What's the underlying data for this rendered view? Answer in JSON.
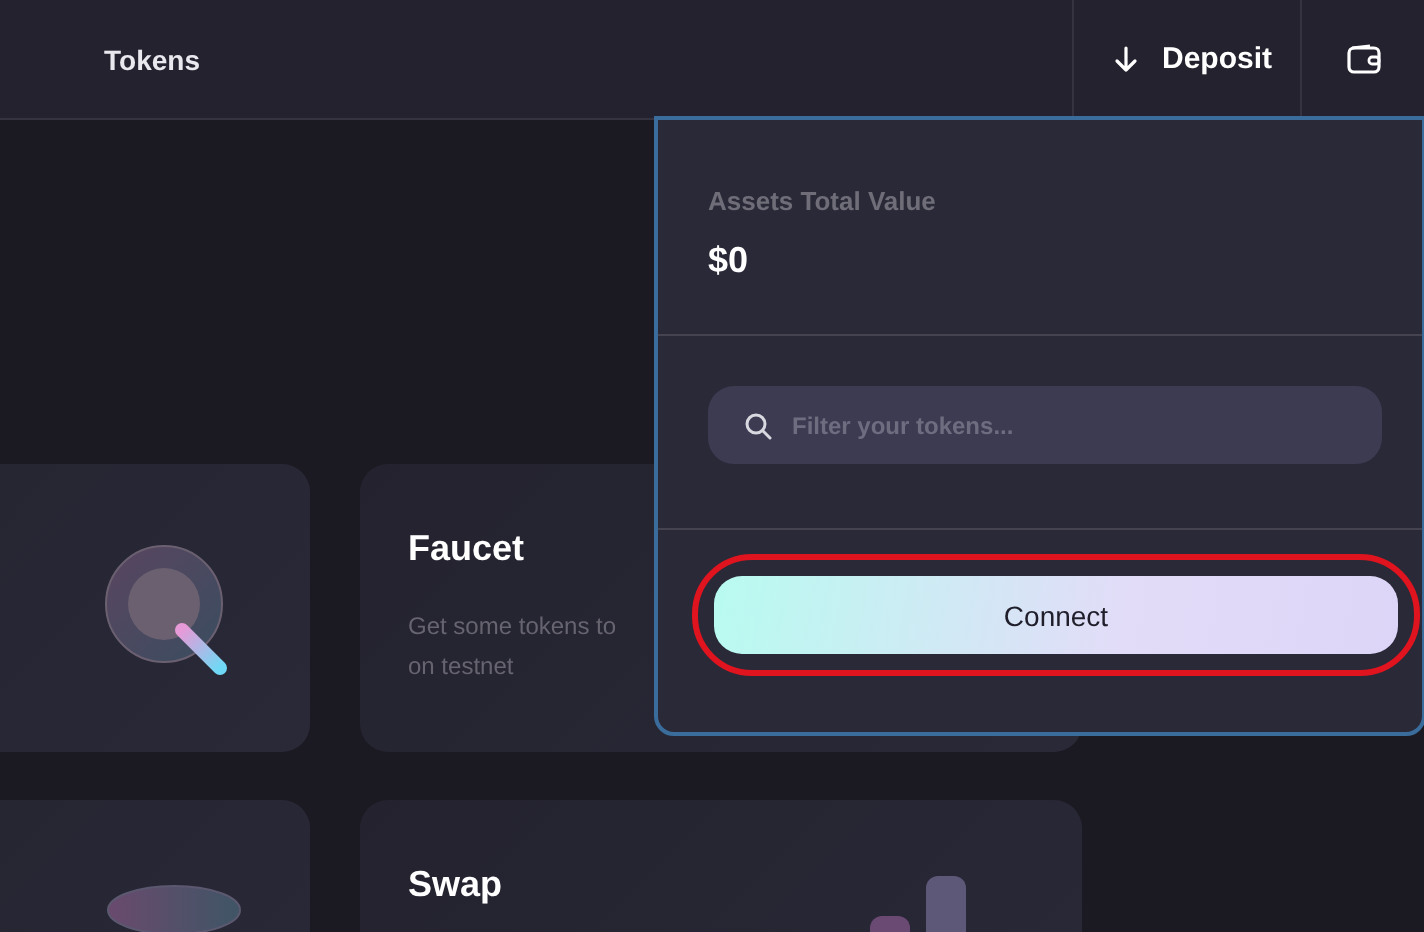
{
  "header": {
    "title": "Tokens",
    "deposit_label": "Deposit"
  },
  "cards": [
    {
      "kind": "magnifier"
    },
    {
      "kind": "text",
      "title": "Faucet",
      "lines": [
        "Get some tokens to",
        "on testnet"
      ]
    },
    {
      "kind": "disk"
    },
    {
      "kind": "bars",
      "title": "Swap"
    }
  ],
  "wallet_panel": {
    "label": "Assets Total Value",
    "total": "$0",
    "search": {
      "placeholder": "Filter your tokens..."
    },
    "connect_button": "Connect",
    "connect_highlighted": true
  }
}
